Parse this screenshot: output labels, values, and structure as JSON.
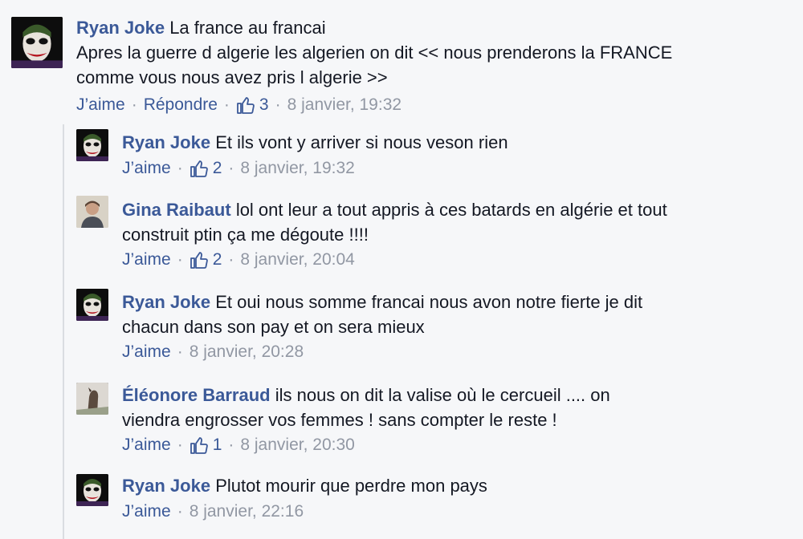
{
  "actions": {
    "like": "J’aime",
    "reply": "Répondre",
    "separator": "·"
  },
  "comments": [
    {
      "author": "Ryan Joke",
      "text": "La france au francai\nApres la guerre d algerie les algerien on dit << nous prenderons la FRANCE\ncomme vous nous avez pris l algerie >>",
      "likes": "3",
      "time": "8 janvier, 19:32",
      "avatar_icon": "joker-avatar-icon"
    },
    {
      "author": "Ryan Joke",
      "text": "Et ils vont y arriver si nous veson rien",
      "likes": "2",
      "time": "8 janvier, 19:32",
      "avatar_icon": "joker-avatar-icon"
    },
    {
      "author": "Gina Raibaut",
      "text": "lol ont leur a tout appris à ces batards en algérie et tout\nconstruit ptin ça me dégoute !!!!",
      "likes": "2",
      "time": "8 janvier, 20:04",
      "avatar_icon": "person-photo-avatar-icon"
    },
    {
      "author": "Ryan Joke",
      "text": "Et oui nous somme francai nous avon notre fierte je dit\nchacun dans son pay et on sera mieux",
      "likes": "",
      "time": "8 janvier, 20:28",
      "avatar_icon": "joker-avatar-icon"
    },
    {
      "author": "Éléonore Barraud",
      "text": "ils nous on dit la valise où le cercueil .... on\nviendra engrosser vos femmes ! sans compter le reste !",
      "likes": "1",
      "time": "8 janvier, 20:30",
      "avatar_icon": "horse-photo-avatar-icon"
    },
    {
      "author": "Ryan Joke",
      "text": "Plutot mourir que perdre mon pays",
      "likes": "",
      "time": "8 janvier, 22:16",
      "avatar_icon": "joker-avatar-icon"
    }
  ],
  "colors": {
    "author": "#3b5998",
    "meta": "#9197a3",
    "background": "#f6f7f9"
  }
}
